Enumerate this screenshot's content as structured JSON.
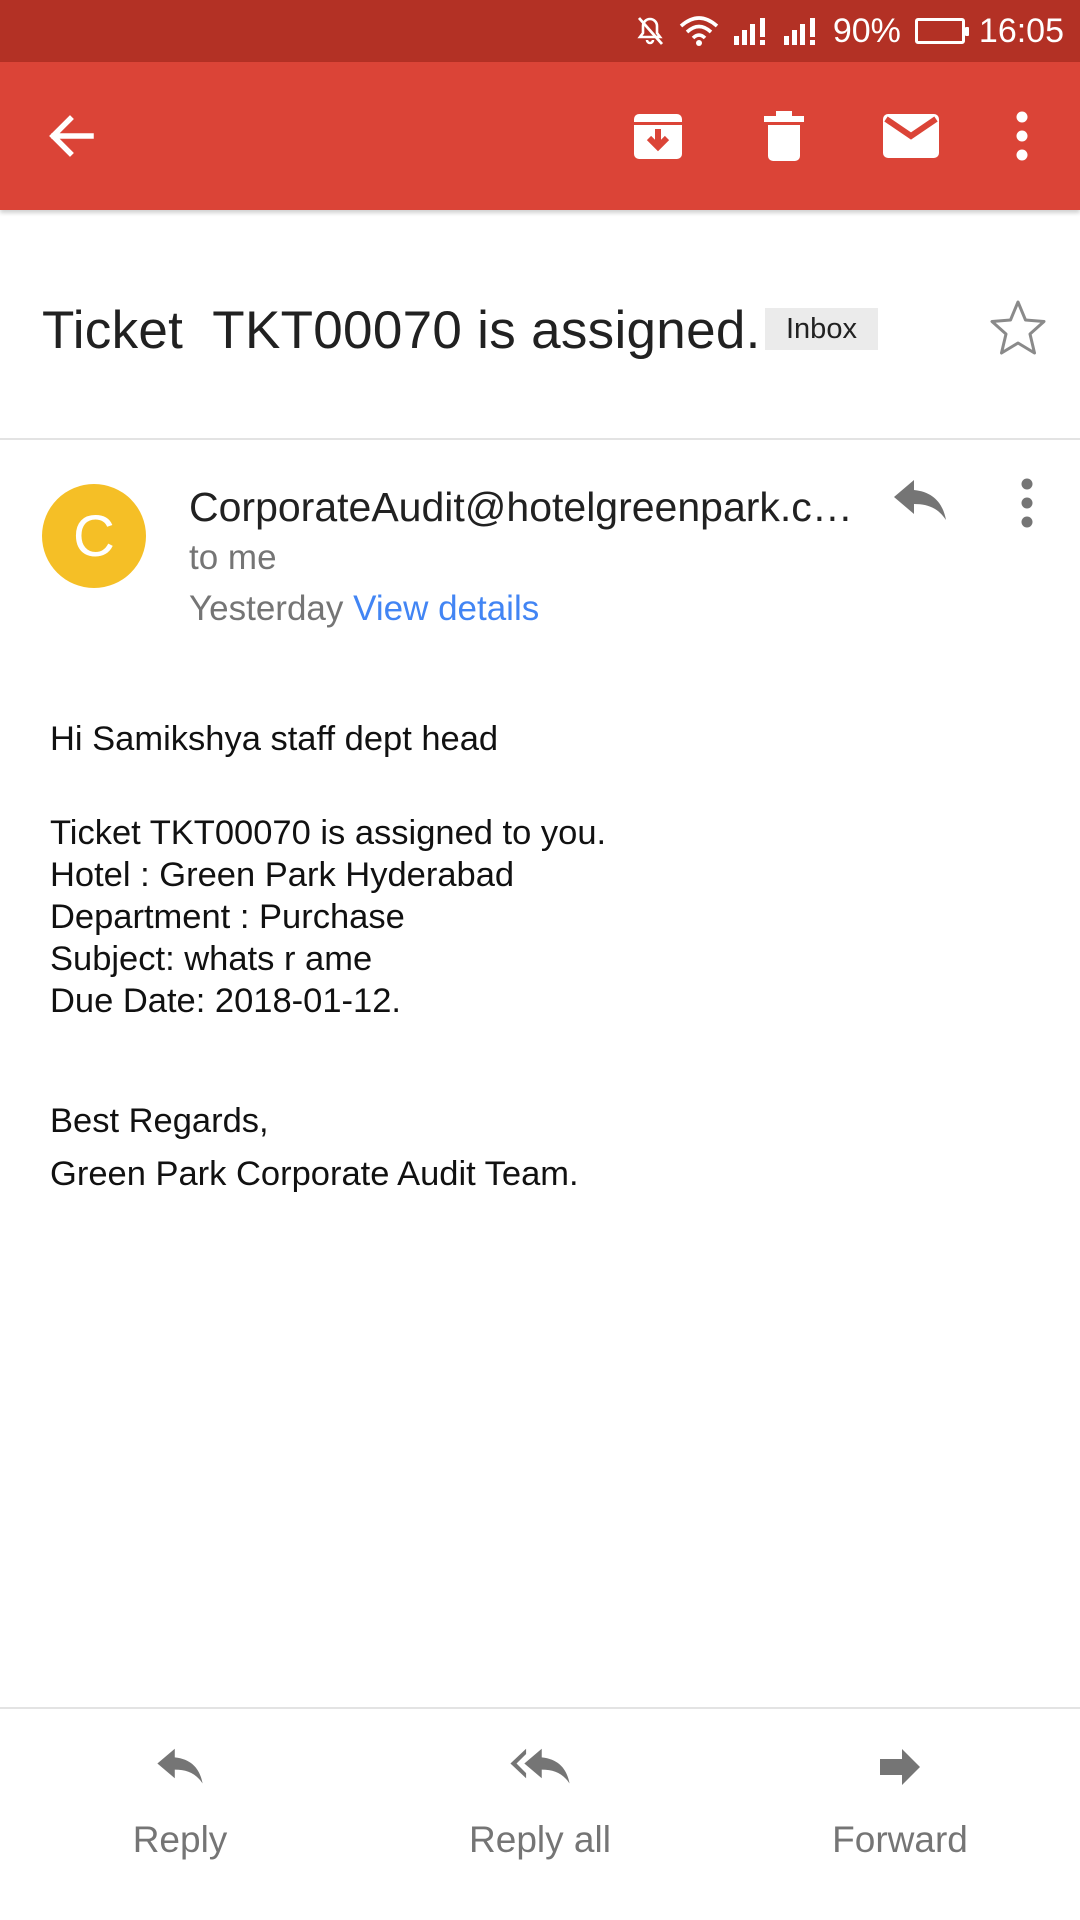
{
  "status_bar": {
    "battery": "90%",
    "time": "16:05",
    "battery_level": 0.9,
    "icons": [
      "mute-icon",
      "wifi-icon",
      "signal-icon",
      "signal-icon",
      "battery-icon"
    ]
  },
  "app_bar": {
    "color": "#db4437",
    "actions": [
      "back-arrow-icon",
      "archive-icon",
      "delete-icon",
      "mark-unread-icon",
      "more-vert-icon"
    ]
  },
  "subject": {
    "title": "Ticket  TKT00070 is assigned.",
    "label": "Inbox"
  },
  "sender": {
    "avatar_letter": "C",
    "avatar_color": "#f5bf26",
    "email": "CorporateAudit@hotelgreenpark.com",
    "to": "to me",
    "date": "Yesterday",
    "view_details": "View details"
  },
  "body": {
    "greeting": "Hi Samikshya staff dept head",
    "lines": [
      "Ticket TKT00070 is assigned to you.",
      "Hotel : Green Park Hyderabad",
      "Department : Purchase",
      "Subject: whats r ame",
      "Due Date: 2018-01-12."
    ],
    "signature": [
      "Best Regards,",
      "Green Park Corporate Audit Team."
    ]
  },
  "actions": {
    "reply": "Reply",
    "reply_all": "Reply all",
    "forward": "Forward"
  },
  "colors": {
    "status_bar": "#b33125",
    "link": "#4285f4",
    "secondary_text": "#757575"
  }
}
